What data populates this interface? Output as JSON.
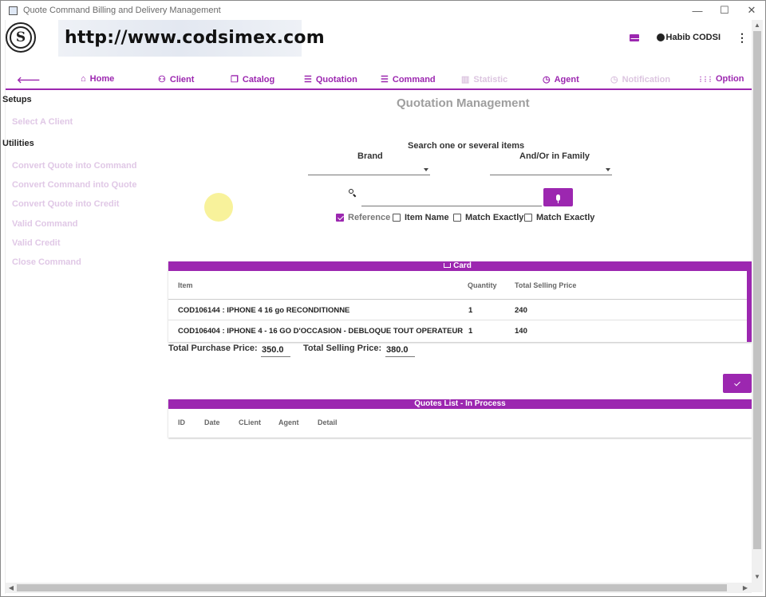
{
  "window": {
    "title": "Quote Command Billing and Delivery Management",
    "minimize": "—",
    "maximize": "☐",
    "close": "✕"
  },
  "header": {
    "logo_letter": "S",
    "banner_text": "http://www.codsimex.com",
    "user_name": "Habib CODSI",
    "menu_glyph": "⋮"
  },
  "nav": {
    "back_glyph": "🡐",
    "items": [
      {
        "label": "Home",
        "icon": "home-icon",
        "glyph": "⌂",
        "enabled": true
      },
      {
        "label": "Client",
        "icon": "client-icon",
        "glyph": "⚇",
        "enabled": true
      },
      {
        "label": "Catalog",
        "icon": "catalog-icon",
        "glyph": "❐",
        "enabled": true
      },
      {
        "label": "Quotation",
        "icon": "quotation-icon",
        "glyph": "☰",
        "enabled": true
      },
      {
        "label": "Command",
        "icon": "command-icon",
        "glyph": "☰",
        "enabled": true
      },
      {
        "label": "Statistic",
        "icon": "chart-icon",
        "glyph": "▥",
        "enabled": false
      },
      {
        "label": "Agent",
        "icon": "alarm-icon",
        "glyph": "◷",
        "enabled": true
      },
      {
        "label": "Notification",
        "icon": "notification-icon",
        "glyph": "◷",
        "enabled": false
      },
      {
        "label": "Option",
        "icon": "grid-icon",
        "glyph": "⋮⋮⋮",
        "enabled": true
      }
    ]
  },
  "sidebar": {
    "setups_heading": "Setups",
    "setups_items": [
      "Select A Client"
    ],
    "utilities_heading": "Utilities",
    "utilities_items": [
      "Convert Quote into Command",
      "Convert Command into Quote",
      "Convert Quote into Credit",
      "Valid Command",
      "Valid Credit",
      "Close Command"
    ]
  },
  "main": {
    "title": "Quotation Management",
    "search_label": "Search one or several items",
    "brand_label": "Brand",
    "family_label": "And/Or in Family",
    "search_value": "",
    "checkboxes": [
      {
        "label": "Reference",
        "checked": true
      },
      {
        "label": "Item Name",
        "checked": false
      },
      {
        "label": "Match Exactly",
        "checked": false
      },
      {
        "label": "Match Exactly",
        "checked": false
      }
    ]
  },
  "card": {
    "title": "Card",
    "columns": [
      "Item",
      "Quantity",
      "Total Selling Price"
    ],
    "rows": [
      {
        "item": "COD106144 : IPHONE 4 16 go  RECONDITIONNE",
        "quantity": "1",
        "total": "240"
      },
      {
        "item": "COD106404 : IPHONE 4 - 16 GO  D'OCCASION - DEBLOQUE TOUT OPERATEUR",
        "quantity": "1",
        "total": "140"
      }
    ],
    "total_purchase_label": "Total Purchase Price:",
    "total_purchase_value": "350.0",
    "total_selling_label": "Total Selling Price:",
    "total_selling_value": "380.0"
  },
  "quotes": {
    "title": "Quotes List - In Process",
    "columns": [
      "ID",
      "Date",
      "CLient",
      "Agent",
      "Detail"
    ]
  },
  "colors": {
    "accent": "#9c27b0",
    "disabled": "#dcc5e0",
    "sidebar_link": "#e0c8e6"
  }
}
